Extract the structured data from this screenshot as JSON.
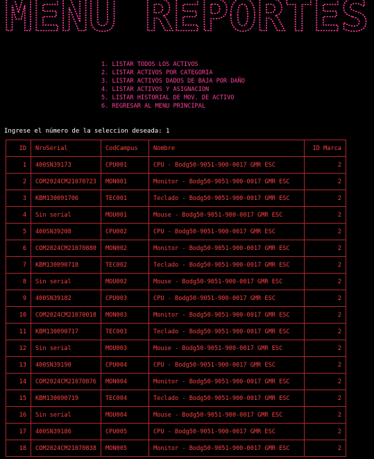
{
  "banner": {
    "text": "MENU REPORTES",
    "color": "#ff3fa0"
  },
  "menu": {
    "items": [
      "1. LISTAR TODOS LOS ACTIVOS",
      "2. LISTAR ACTIVOS POR CATEGORIA",
      "3. LISTAR ACTIVOS DADOS DE BAJA POR DAÑO",
      "4. LISTAR ACTIVOS Y ASIGNACION",
      "5. LISTAR HISTORIAL DE MOV. DE ACTIVO",
      "6. REGRESAR AL MENU PRINCIPAL"
    ]
  },
  "prompt": {
    "label": "Ingrese el número de la seleccion deseada: ",
    "value": "1"
  },
  "table": {
    "headers": [
      "ID",
      "NroSerial",
      "CodCampus",
      "Nombre",
      "ID Marca"
    ],
    "rows": [
      [
        "1",
        "400SN39173",
        "CPU001",
        "CPU - Bodg50-9051-900-0017 GMR ESC",
        "2"
      ],
      [
        "2",
        "COM2024CM21070723",
        "MON001",
        "Monitor - Bodg50-9051-900-0017 GMR ESC",
        "2"
      ],
      [
        "3",
        "KBM130091706",
        "TEC001",
        "Teclado - Bodg50-9051-900-0017 GMR ESC",
        "2"
      ],
      [
        "4",
        "Sin serial",
        "MOU001",
        "Mouse - Bodg50-9051-900-0017 GMR ESC",
        "2"
      ],
      [
        "5",
        "400SN39208",
        "CPU002",
        "CPU - Bodg50-9051-900-0017 GMR ESC",
        "2"
      ],
      [
        "6",
        "COM2024CM21070880",
        "MON002",
        "Monitor - Bodg50-9051-900-0017 GMR ESC",
        "2"
      ],
      [
        "7",
        "KBM130090718",
        "TEC002",
        "Teclado - Bodg50-9051-900-0017 GMR ESC",
        "2"
      ],
      [
        "8",
        "Sin serial",
        "MOU002",
        "Mouse - Bodg50-9051-900-0017 GMR ESC",
        "2"
      ],
      [
        "9",
        "400SN39182",
        "CPU003",
        "CPU - Bodg50-9051-900-0017 GMR ESC",
        "2"
      ],
      [
        "10",
        "COM2024CM21070018",
        "MON003",
        "Monitor - Bodg50-9051-900-0017 GMR ESC",
        "2"
      ],
      [
        "11",
        "KBM130090717",
        "TEC003",
        "Teclado - Bodg50-9051-900-0017 GMR ESC",
        "2"
      ],
      [
        "12",
        "Sin serial",
        "MOU003",
        "Mouse - Bodg50-9051-900-0017 GMR ESC",
        "2"
      ],
      [
        "13",
        "400SN39190",
        "CPU004",
        "CPU - Bodg50-9051-900-0017 GMR ESC",
        "2"
      ],
      [
        "14",
        "COM2024CM21070876",
        "MON004",
        "Monitor - Bodg50-9051-900-0017 GMR ESC",
        "2"
      ],
      [
        "15",
        "KBM130090719",
        "TEC004",
        "Teclado - Bodg50-9051-900-0017 GMR ESC",
        "2"
      ],
      [
        "16",
        "Sin serial",
        "MOU004",
        "Mouse - Bodg50-9051-900-0017 GMR ESC",
        "2"
      ],
      [
        "17",
        "400SN39186",
        "CPU005",
        "CPU - Bodg50-9051-900-0017 GMR ESC",
        "2"
      ],
      [
        "18",
        "COM2024CM21070838",
        "MON005",
        "Monitor - Bodg50-9051-900-0017 GMR ESC",
        "2"
      ]
    ]
  },
  "colors": {
    "background": "#000000",
    "menu_text": "#ff3fa0",
    "table_text": "#ff4040",
    "table_border": "#b3262b",
    "prompt_text": "#ffffff"
  }
}
